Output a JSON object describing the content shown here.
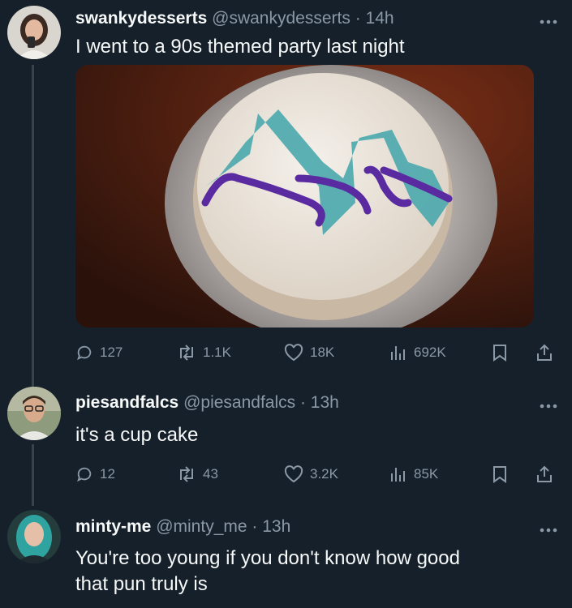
{
  "tweets": [
    {
      "name": "swankydesserts",
      "handle": "@swankydesserts",
      "time": "· 14h",
      "text": "I went to a 90s themed party last night",
      "media_icon": "cake-photo",
      "stats": {
        "replies": "127",
        "retweets": "1.1K",
        "likes": "18K",
        "views": "692K"
      }
    },
    {
      "name": "piesandfalcs",
      "handle": "@piesandfalcs",
      "time": "· 13h",
      "text": "it's a cup cake",
      "stats": {
        "replies": "12",
        "retweets": "43",
        "likes": "3.2K",
        "views": "85K"
      }
    },
    {
      "name": "minty-me",
      "handle": "@minty_me",
      "time": "· 13h",
      "text": "You're too young if you don't know how good that pun truly is"
    }
  ],
  "colors": {
    "background": "#15202b",
    "secondary_text": "#8b98a5",
    "primary_text": "#e7e9ea",
    "thread_line": "#38444d"
  }
}
